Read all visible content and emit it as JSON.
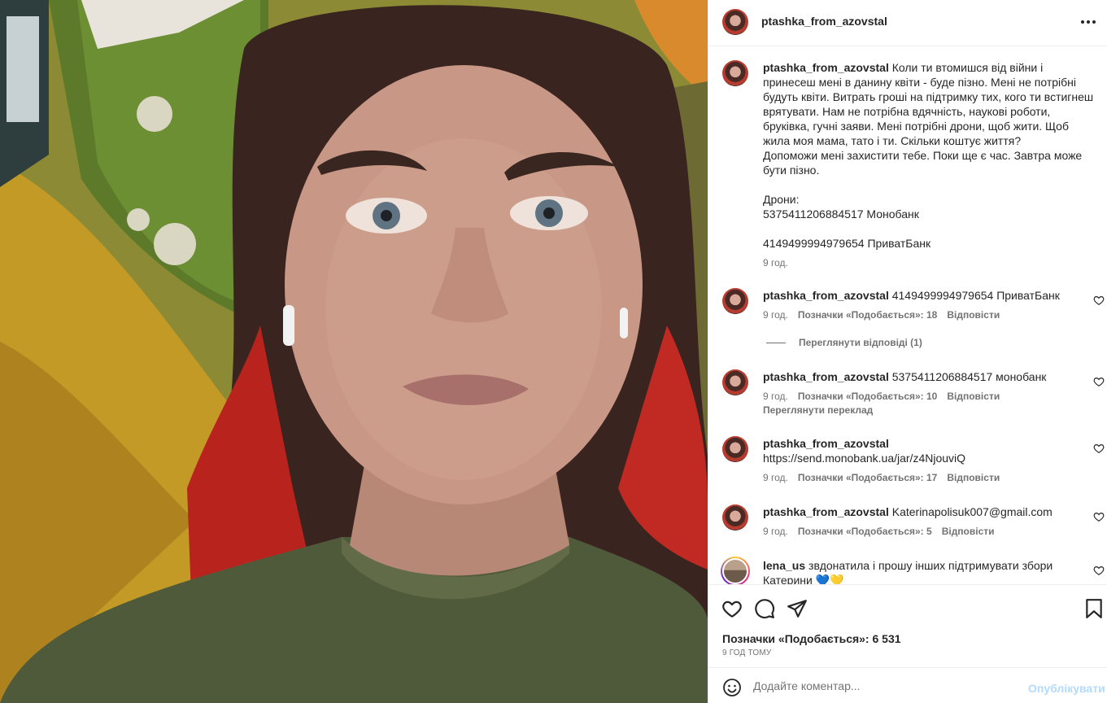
{
  "post": {
    "username": "ptashka_from_azovstal",
    "caption": {
      "username": "ptashka_from_azovstal",
      "text": "Коли ти втомишся від війни і принесеш мені в данину квіти - буде пізно. Мені не потрібні будуть квіти. Витрать гроші на підтримку тих, кого ти встигнеш врятувати. Нам не потрібна вдячність, наукові роботи, бруківка, гучні заяви. Мені потрібні дрони, щоб жити. Щоб жила моя мама, тато і ти. Скільки коштує життя?\nДопоможи мені захистити тебе. Поки ще є час. Завтра може бути пізно.\n\nДрони:\n5375411206884517 Монобанк\n\n4149499994979654 ПриватБанк",
      "time": "9 год."
    },
    "comments": [
      {
        "username": "ptashka_from_azovstal",
        "text": "4149499994979654 ПриватБанк",
        "time": "9 год.",
        "likes": "Позначки «Подобається»: 18",
        "reply": "Відповісти",
        "view_replies": "Переглянути відповіді (1)"
      },
      {
        "username": "ptashka_from_azovstal",
        "text": "5375411206884517 монобанк",
        "time": "9 год.",
        "likes": "Позначки «Подобається»: 10",
        "reply": "Відповісти",
        "translate": "Переглянути переклад"
      },
      {
        "username": "ptashka_from_azovstal",
        "text": "https://send.monobank.ua/jar/z4NjouviQ",
        "time": "9 год.",
        "likes": "Позначки «Подобається»: 17",
        "reply": "Відповісти"
      },
      {
        "username": "ptashka_from_azovstal",
        "text": "Katerinapolisuk007@gmail.com",
        "time": "9 год.",
        "likes": "Позначки «Подобається»: 5",
        "reply": "Відповісти"
      },
      {
        "username": "lena_us",
        "text": "звдонатила і прошу інших підтримувати збори Катерини 💙💛"
      }
    ],
    "total_likes": "Позначки «Подобається»: 6 531",
    "time_ago": "9 ГОД ТОМУ"
  },
  "composer": {
    "placeholder": "Додайте коментар...",
    "publish": "Опублікувати"
  },
  "icons": [
    "more-icon",
    "heart-icon",
    "comment-icon",
    "share-icon",
    "bookmark-icon",
    "emoji-icon"
  ],
  "colors": {
    "text": "#262626",
    "secondary": "#737373",
    "publish_disabled": "#b3dbff",
    "border": "#efefef"
  }
}
